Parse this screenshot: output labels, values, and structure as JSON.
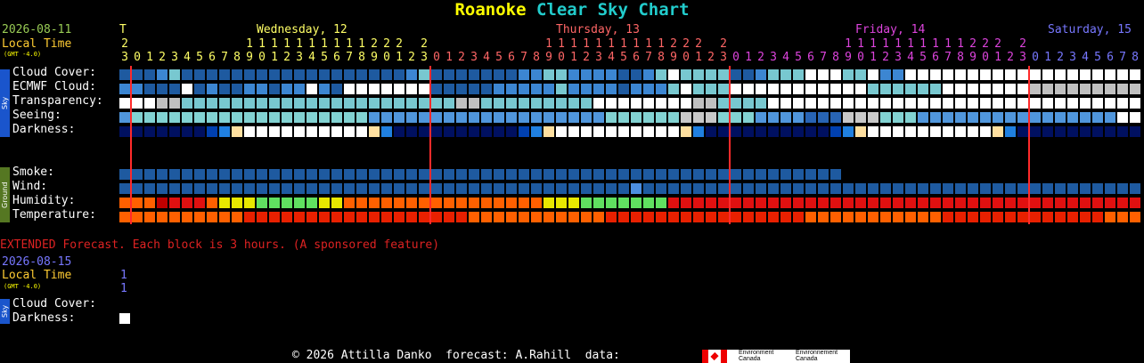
{
  "title": {
    "location": "Roanoke",
    "rest": "Clear Sky Chart"
  },
  "date": "2026-08-11",
  "local_time_label": "Local Time",
  "gmt_note": "(GMT -4.0)",
  "day_headers": [
    {
      "text": "T",
      "color": "#ffff66"
    },
    {
      "text": "Wednesday, 12",
      "color": "#ffff66"
    },
    {
      "text": "Thursday, 13",
      "color": "#ff6666"
    },
    {
      "text": "Friday, 14",
      "color": "#dd44dd"
    },
    {
      "text": "Saturday, 15",
      "color": "#7777ff"
    }
  ],
  "hour_tens": "2         1111111111222 2         1111111111222 2         1111111111222 2",
  "hour_units": "3012345678901234567890123012345678901234567890123012345678901234567890123012345678",
  "sky_label": "Sky",
  "ground_label": "Ground",
  "rows": {
    "cloud": "Cloud Cover:",
    "ecmwf": "ECMWF Cloud:",
    "transparency": "Transparency:",
    "seeing": "Seeing:",
    "darkness": "Darkness:",
    "smoke": "Smoke:",
    "wind": "Wind:",
    "humidity": "Humidity:",
    "temperature": "Temperature:"
  },
  "extended": {
    "notice": "EXTENDED Forecast. Each block is 3 hours. (A sponsored feature)",
    "date": "2026-08-15",
    "local_time_label": "Local Time",
    "gmt_note": "(GMT -4.0)",
    "hour_tens": "1",
    "hour_units": "1",
    "sky_label": "Sky",
    "cloud": "Cloud Cover:",
    "darkness": "Darkness:"
  },
  "footer": {
    "copyright": "© 2026 Attilla Danko  forecast: A.Rahill  data:",
    "env_en": "Environment\nCanada",
    "env_fr": "Environnement\nCanada"
  },
  "colors": {
    "title_location": "#ffff00",
    "title_rest": "#22cccc",
    "date": "#99cc55",
    "local_time": "#ffcc33",
    "extended_notice": "#dd2222",
    "extended_date": "#7777ff",
    "midnight_line": "#ff2a2a"
  },
  "series": {
    "cloud": "DDDLMDDDDDDDDDDDDDDDDDDLMDDDDDDDLLMMLLLLDDLMWMMMMDDLMMMWWWMMWLLWWWWWWWWWWWWWWWWWWWWWW",
    "ecmwf": "LLDDDWDLDDLLDLLWLDWWWWWWWDDDDDLLLLLMLLLLDLLLMWMMMWWWWWWWWWWWMMMMMMWWWWWWWGGGGGGGGGGGG",
    "transparency": "WWWGGMMMMMMMMMMMMMMMMMMMMMMGGMMMMMMMMMWWWWWWWWGGMMMMWWWWWWWWWWWWWWWWWWWWWWWWWWWWWWW",
    "seeing": "LTTTTTTTTTTTTTTTTTTTLLLLLLLLLLLLLLLLLLLTTTTTTGGGTTTLLLLDDDGGGTTTLLLLLLLLLLLLLLLLWWWGG",
    "darkness": "NNNNNNNMBSWWWWWWWWWWSBNNNNNNNNNNMBSWWWWWWWWWWSBNNNNNNNNNNMBSWWWWWWWWWWSBNNNNNNNNNNMBS",
    "smoke_len": 58,
    "wind": "DDDDDDDDDDDDDDDDDDDDDDDDDDDDDDDDDDDDDDDDDLDDDDDDDDDDDDDDDDDDDDDDDDDDDDDDDDDDDDDDDDDD",
    "humidity": "OOODRRROYYYGGGGGYYOOOOOOOOOOOOOOOOYYYGGGGGGGRRRRRRRRRRRRRRRRRRRRRRRRRRRRRRRRRRRRRRRRR",
    "temperature": "OOOOOOOOOORRRRRRRRRRRRRRRRRROOOOOOOOOOORRRRRRRRRRRRRRRROOOOOOOOOOORRRRRRRRRRRRROOOOOOO"
  }
}
